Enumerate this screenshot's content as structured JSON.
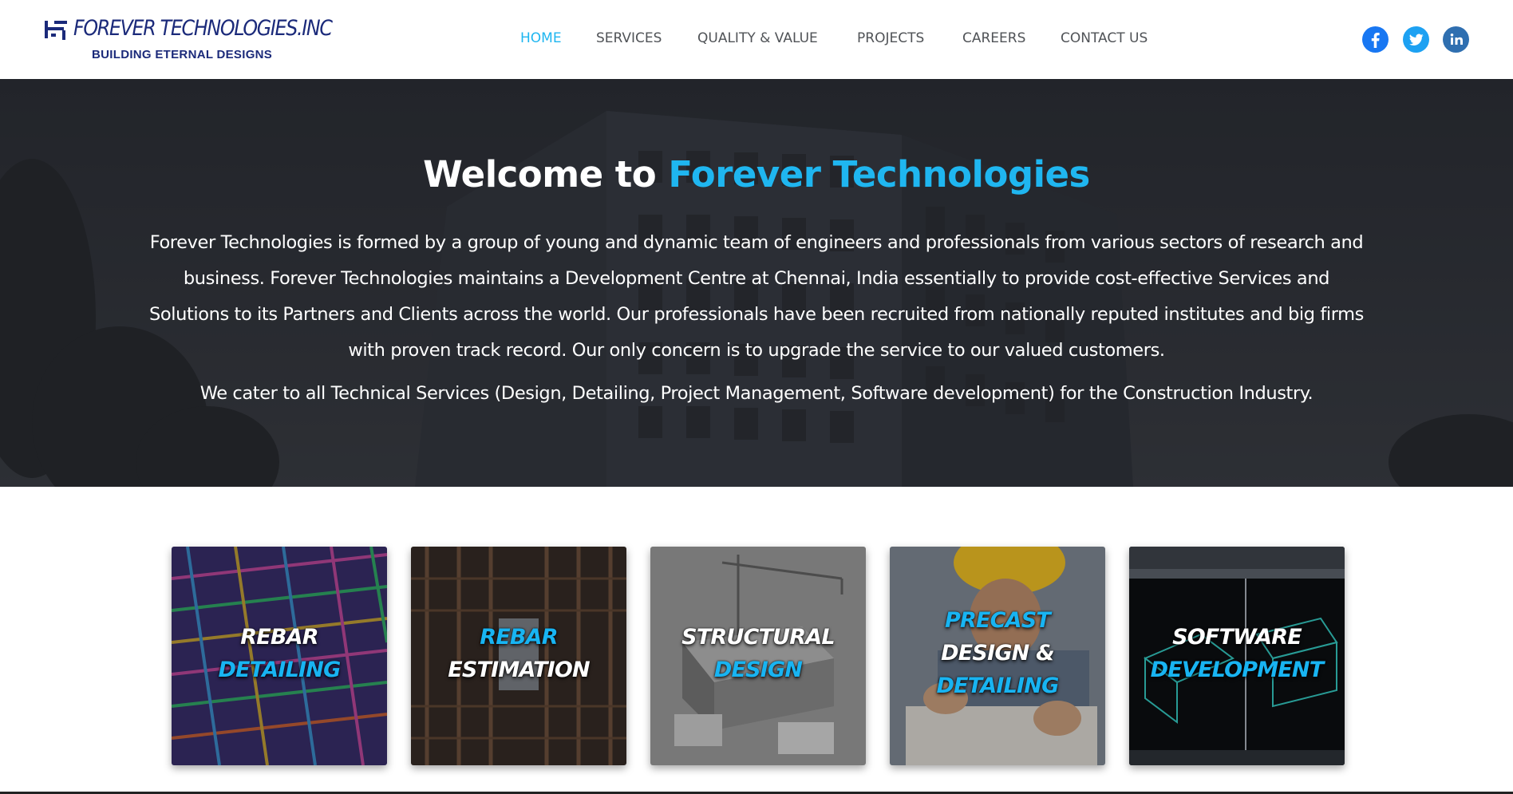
{
  "header": {
    "logo_title": "FOREVER TECHNOLOGIES.INC",
    "logo_tagline": "BUILDING ETERNAL DESIGNS",
    "nav": [
      {
        "label": "HOME",
        "active": true
      },
      {
        "label": "SERVICES",
        "active": false
      },
      {
        "label": "QUALITY & VALUE",
        "active": false
      },
      {
        "label": "PROJECTS",
        "active": false
      },
      {
        "label": "CAREERS",
        "active": false
      },
      {
        "label": "CONTACT US",
        "active": false
      }
    ],
    "social": [
      {
        "icon": "facebook-icon",
        "color": "#1877f2"
      },
      {
        "icon": "twitter-icon",
        "color": "#1da1f2"
      },
      {
        "icon": "linkedin-icon",
        "color": "#2f6fb0"
      }
    ]
  },
  "hero": {
    "title_prefix": "Welcome to ",
    "title_accent": "Forever Technologies",
    "paragraph": "Forever Technologies is formed by a group of young and dynamic team of engineers and professionals from various sectors of research and business. Forever Technologies maintains a Development Centre at Chennai, India essentially to provide cost-effective Services and Solutions to its Partners and Clients across the world. Our professionals have been recruited from nationally reputed institutes and big firms with proven track record. Our only concern is to upgrade the service to our valued customers.",
    "paragraph2": "We cater to all Technical Services (Design, Detailing, Project Management, Software development) for the Construction Industry."
  },
  "cards": [
    {
      "lines": [
        {
          "text": "REBAR",
          "color": "white"
        },
        {
          "text": "DETAILING",
          "color": "blue"
        }
      ]
    },
    {
      "lines": [
        {
          "text": "REBAR",
          "color": "blue"
        },
        {
          "text": "ESTIMATION",
          "color": "white"
        }
      ]
    },
    {
      "lines": [
        {
          "text": "STRUCTURAL",
          "color": "white"
        },
        {
          "text": "DESIGN",
          "color": "blue"
        }
      ]
    },
    {
      "lines": [
        {
          "text": "PRECAST",
          "color": "blue"
        },
        {
          "text": "DESIGN &",
          "color": "white"
        },
        {
          "text": "DETAILING",
          "color": "blue"
        }
      ]
    },
    {
      "lines": [
        {
          "text": "SOFTWARE",
          "color": "white"
        },
        {
          "text": "DEVELOPMENT",
          "color": "blue"
        }
      ]
    }
  ],
  "colors": {
    "accent": "#1fb6f0",
    "nav_text": "#505357",
    "logo": "#1b2a7a"
  }
}
